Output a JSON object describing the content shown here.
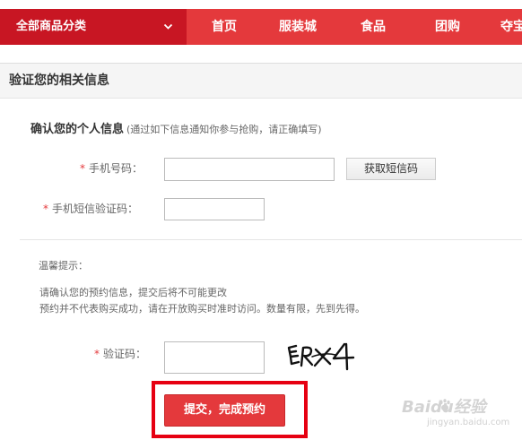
{
  "nav": {
    "category_label": "全部商品分类",
    "items": [
      "首页",
      "服装城",
      "食品",
      "团购",
      "夺宝"
    ]
  },
  "section": {
    "title": "验证您的相关信息"
  },
  "personal_info": {
    "title": "确认您的个人信息",
    "hint": "(通过如下信息通知你参与抢购，请正确填写)",
    "phone_label": "手机号码：",
    "phone_value": "",
    "get_sms_label": "获取短信码",
    "sms_label": "手机短信验证码：",
    "sms_value": ""
  },
  "tips": {
    "title": "温馨提示：",
    "lines": [
      "请确认您的预约信息，提交后将不可能更改",
      "预约并不代表购买成功，请在开放购买时准时访问。数量有限，先到先得。"
    ]
  },
  "captcha": {
    "label": "验证码：",
    "value": "",
    "image_text": "ERX4"
  },
  "submit": {
    "label": "提交，完成预约"
  },
  "watermark": {
    "brand": "Baidu经验",
    "sub": "jingyan.baidu.com"
  },
  "colors": {
    "nav_red": "#e4393c",
    "nav_dark_red": "#c81623",
    "required_star": "#e4393c",
    "highlight_frame": "#e60012"
  }
}
